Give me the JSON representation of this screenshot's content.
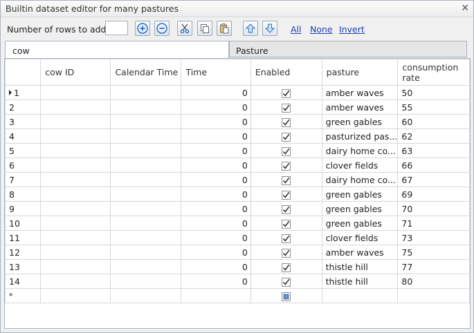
{
  "window": {
    "title": "Builtin dataset editor for many pastures",
    "close_glyph": "✕"
  },
  "toolbar": {
    "rows_label": "Number of rows to add:",
    "rows_value": "",
    "links": {
      "all": "All",
      "none": "None",
      "invert": "Invert"
    }
  },
  "tabs": [
    {
      "label": "cow"
    },
    {
      "label": "Pasture"
    }
  ],
  "table": {
    "columns": [
      "",
      "cow ID",
      "Calendar Time",
      "Time",
      "Enabled",
      "pasture",
      "consumption\nrate"
    ],
    "rows": [
      {
        "num": "1",
        "time": "0",
        "pasture": "amber waves",
        "rate": "50"
      },
      {
        "num": "2",
        "time": "0",
        "pasture": "amber waves",
        "rate": "55"
      },
      {
        "num": "3",
        "time": "0",
        "pasture": "green gables",
        "rate": "60"
      },
      {
        "num": "4",
        "time": "0",
        "pasture": "pasturized pas...",
        "rate": "62"
      },
      {
        "num": "5",
        "time": "0",
        "pasture": "dairy home co...",
        "rate": "63"
      },
      {
        "num": "6",
        "time": "0",
        "pasture": "clover fields",
        "rate": "66"
      },
      {
        "num": "7",
        "time": "0",
        "pasture": "dairy home co...",
        "rate": "67"
      },
      {
        "num": "8",
        "time": "0",
        "pasture": "green gables",
        "rate": "69"
      },
      {
        "num": "9",
        "time": "0",
        "pasture": "green gables",
        "rate": "70"
      },
      {
        "num": "10",
        "time": "0",
        "pasture": "green gables",
        "rate": "71"
      },
      {
        "num": "11",
        "time": "0",
        "pasture": "clover fields",
        "rate": "73"
      },
      {
        "num": "12",
        "time": "0",
        "pasture": "amber waves",
        "rate": "75"
      },
      {
        "num": "13",
        "time": "0",
        "pasture": "thistle hill",
        "rate": "77"
      },
      {
        "num": "14",
        "time": "0",
        "pasture": "thistle hill",
        "rate": "80"
      }
    ],
    "new_row_marker": "*"
  },
  "colors": {
    "link": "#1a3fb8",
    "border": "#a9b3bf",
    "button_icon": "#2f6fc4"
  }
}
